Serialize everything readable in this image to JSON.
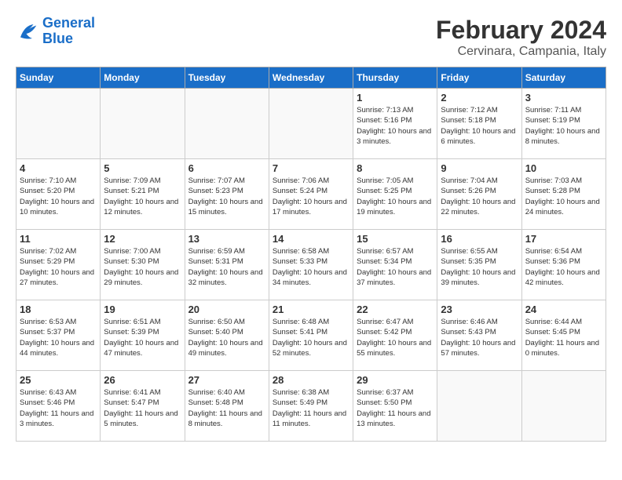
{
  "header": {
    "logo_line1": "General",
    "logo_line2": "Blue",
    "month_title": "February 2024",
    "location": "Cervinara, Campania, Italy"
  },
  "days_of_week": [
    "Sunday",
    "Monday",
    "Tuesday",
    "Wednesday",
    "Thursday",
    "Friday",
    "Saturday"
  ],
  "weeks": [
    [
      {
        "day": "",
        "info": ""
      },
      {
        "day": "",
        "info": ""
      },
      {
        "day": "",
        "info": ""
      },
      {
        "day": "",
        "info": ""
      },
      {
        "day": "1",
        "info": "Sunrise: 7:13 AM\nSunset: 5:16 PM\nDaylight: 10 hours\nand 3 minutes."
      },
      {
        "day": "2",
        "info": "Sunrise: 7:12 AM\nSunset: 5:18 PM\nDaylight: 10 hours\nand 6 minutes."
      },
      {
        "day": "3",
        "info": "Sunrise: 7:11 AM\nSunset: 5:19 PM\nDaylight: 10 hours\nand 8 minutes."
      }
    ],
    [
      {
        "day": "4",
        "info": "Sunrise: 7:10 AM\nSunset: 5:20 PM\nDaylight: 10 hours\nand 10 minutes."
      },
      {
        "day": "5",
        "info": "Sunrise: 7:09 AM\nSunset: 5:21 PM\nDaylight: 10 hours\nand 12 minutes."
      },
      {
        "day": "6",
        "info": "Sunrise: 7:07 AM\nSunset: 5:23 PM\nDaylight: 10 hours\nand 15 minutes."
      },
      {
        "day": "7",
        "info": "Sunrise: 7:06 AM\nSunset: 5:24 PM\nDaylight: 10 hours\nand 17 minutes."
      },
      {
        "day": "8",
        "info": "Sunrise: 7:05 AM\nSunset: 5:25 PM\nDaylight: 10 hours\nand 19 minutes."
      },
      {
        "day": "9",
        "info": "Sunrise: 7:04 AM\nSunset: 5:26 PM\nDaylight: 10 hours\nand 22 minutes."
      },
      {
        "day": "10",
        "info": "Sunrise: 7:03 AM\nSunset: 5:28 PM\nDaylight: 10 hours\nand 24 minutes."
      }
    ],
    [
      {
        "day": "11",
        "info": "Sunrise: 7:02 AM\nSunset: 5:29 PM\nDaylight: 10 hours\nand 27 minutes."
      },
      {
        "day": "12",
        "info": "Sunrise: 7:00 AM\nSunset: 5:30 PM\nDaylight: 10 hours\nand 29 minutes."
      },
      {
        "day": "13",
        "info": "Sunrise: 6:59 AM\nSunset: 5:31 PM\nDaylight: 10 hours\nand 32 minutes."
      },
      {
        "day": "14",
        "info": "Sunrise: 6:58 AM\nSunset: 5:33 PM\nDaylight: 10 hours\nand 34 minutes."
      },
      {
        "day": "15",
        "info": "Sunrise: 6:57 AM\nSunset: 5:34 PM\nDaylight: 10 hours\nand 37 minutes."
      },
      {
        "day": "16",
        "info": "Sunrise: 6:55 AM\nSunset: 5:35 PM\nDaylight: 10 hours\nand 39 minutes."
      },
      {
        "day": "17",
        "info": "Sunrise: 6:54 AM\nSunset: 5:36 PM\nDaylight: 10 hours\nand 42 minutes."
      }
    ],
    [
      {
        "day": "18",
        "info": "Sunrise: 6:53 AM\nSunset: 5:37 PM\nDaylight: 10 hours\nand 44 minutes."
      },
      {
        "day": "19",
        "info": "Sunrise: 6:51 AM\nSunset: 5:39 PM\nDaylight: 10 hours\nand 47 minutes."
      },
      {
        "day": "20",
        "info": "Sunrise: 6:50 AM\nSunset: 5:40 PM\nDaylight: 10 hours\nand 49 minutes."
      },
      {
        "day": "21",
        "info": "Sunrise: 6:48 AM\nSunset: 5:41 PM\nDaylight: 10 hours\nand 52 minutes."
      },
      {
        "day": "22",
        "info": "Sunrise: 6:47 AM\nSunset: 5:42 PM\nDaylight: 10 hours\nand 55 minutes."
      },
      {
        "day": "23",
        "info": "Sunrise: 6:46 AM\nSunset: 5:43 PM\nDaylight: 10 hours\nand 57 minutes."
      },
      {
        "day": "24",
        "info": "Sunrise: 6:44 AM\nSunset: 5:45 PM\nDaylight: 11 hours\nand 0 minutes."
      }
    ],
    [
      {
        "day": "25",
        "info": "Sunrise: 6:43 AM\nSunset: 5:46 PM\nDaylight: 11 hours\nand 3 minutes."
      },
      {
        "day": "26",
        "info": "Sunrise: 6:41 AM\nSunset: 5:47 PM\nDaylight: 11 hours\nand 5 minutes."
      },
      {
        "day": "27",
        "info": "Sunrise: 6:40 AM\nSunset: 5:48 PM\nDaylight: 11 hours\nand 8 minutes."
      },
      {
        "day": "28",
        "info": "Sunrise: 6:38 AM\nSunset: 5:49 PM\nDaylight: 11 hours\nand 11 minutes."
      },
      {
        "day": "29",
        "info": "Sunrise: 6:37 AM\nSunset: 5:50 PM\nDaylight: 11 hours\nand 13 minutes."
      },
      {
        "day": "",
        "info": ""
      },
      {
        "day": "",
        "info": ""
      }
    ]
  ]
}
